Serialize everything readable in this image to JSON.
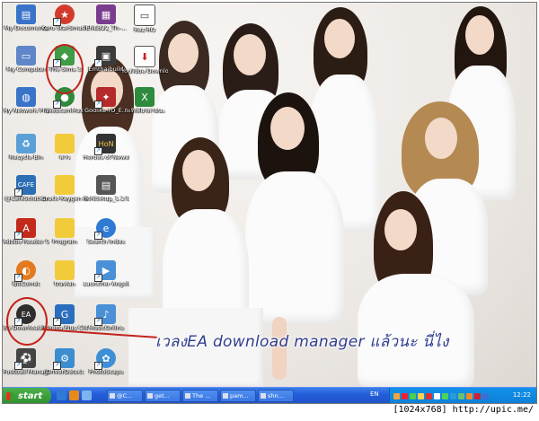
{
  "desktop": {
    "icons": [
      {
        "label": "My Documents",
        "name": "my-documents-icon",
        "color": "#3a74c9"
      },
      {
        "label": "My Computer",
        "name": "my-computer-icon",
        "color": "#5f86c9"
      },
      {
        "label": "My Network Places",
        "name": "my-network-icon",
        "color": "#3a74c9"
      },
      {
        "label": "Recycle Bin",
        "name": "recycle-bin-icon",
        "color": "#5aa0d8"
      },
      {
        "label": "@CafeSolution",
        "name": "cafe-solution-icon",
        "color": "#2d6fb5"
      },
      {
        "label": "Adobe Reader 9",
        "name": "adobe-reader-icon",
        "color": "#c22a1c"
      },
      {
        "label": "BitComet",
        "name": "bitcomet-icon",
        "color": "#e47a1e"
      },
      {
        "label": "EA Download Manager",
        "name": "ea-download-manager-icon",
        "color": "#2e2e2e"
      },
      {
        "label": "Football Manager 2010",
        "name": "football-manager-icon",
        "color": "#444444"
      },
      {
        "label": "Kero StarSmash",
        "name": "kero-icon",
        "color": "#d33a2c"
      },
      {
        "label": "The Sims 3",
        "name": "the-sims-3-icon",
        "color": "#3f9c45"
      },
      {
        "label": "WebcamMax",
        "name": "webcammax-icon",
        "color": "#2f8a3b"
      },
      {
        "label": "ดาว",
        "name": "folder-icon",
        "color": "#f2cb3b"
      },
      {
        "label": "Crack-Keygen Sims 3 EA",
        "name": "crack-folder-icon",
        "color": "#f2cb3b"
      },
      {
        "label": "Program",
        "name": "program-folder-icon",
        "color": "#f2cb3b"
      },
      {
        "label": "travian",
        "name": "travian-folder-icon",
        "color": "#f2cb3b"
      },
      {
        "label": "Garena Plus Client 5.8",
        "name": "garena-icon",
        "color": "#2a6ec0"
      },
      {
        "label": "DriverDetect",
        "name": "driver-detect-icon",
        "color": "#3c8dd0"
      },
      {
        "label": "ENLB22_Th-...",
        "name": "winrar-icon",
        "color": "#7a3d8e"
      },
      {
        "label": "Emthaibuild",
        "name": "emthai-icon",
        "color": "#3b3b3b"
      },
      {
        "label": "Godlike-rO_E...",
        "name": "godlike-icon",
        "color": "#b52a2a"
      },
      {
        "label": "Heroes of Newerth",
        "name": "hon-icon",
        "color": "#333333"
      },
      {
        "label": "HoNSetup_1.2.8",
        "name": "hon-setup-icon",
        "color": "#555555"
      },
      {
        "label": "Search Index",
        "name": "search-index-icon",
        "color": "#2f7bd4"
      },
      {
        "label": "Launcher AngelLove",
        "name": "launcher-icon",
        "color": "#4a90d6"
      },
      {
        "label": "MusicOnline",
        "name": "music-online-icon",
        "color": "#4a90d6"
      },
      {
        "label": "PhotoScape",
        "name": "photoscape-icon",
        "color": "#3e8fd6"
      },
      {
        "label": "Rez-RO",
        "name": "rez-ro-icon",
        "color": "#ffffff"
      },
      {
        "label": "YouTube Downloader",
        "name": "youtube-downloader-icon",
        "color": "#ffffff"
      },
      {
        "label": "กะทิเดียวดายนะ",
        "name": "excel-file-icon",
        "color": "#2e8b3d"
      }
    ],
    "annotation": "เวลงEA download manager  แล้วนะ นี่ไง",
    "accent": "#c2231b"
  },
  "taskbar": {
    "start_label": "start",
    "tasks": [
      "@C...",
      "get...",
      "The ...",
      "pam...",
      "shn..."
    ],
    "language": "EN",
    "clock": "12:22"
  },
  "watermark": "[1024x768] http://upic.me/"
}
